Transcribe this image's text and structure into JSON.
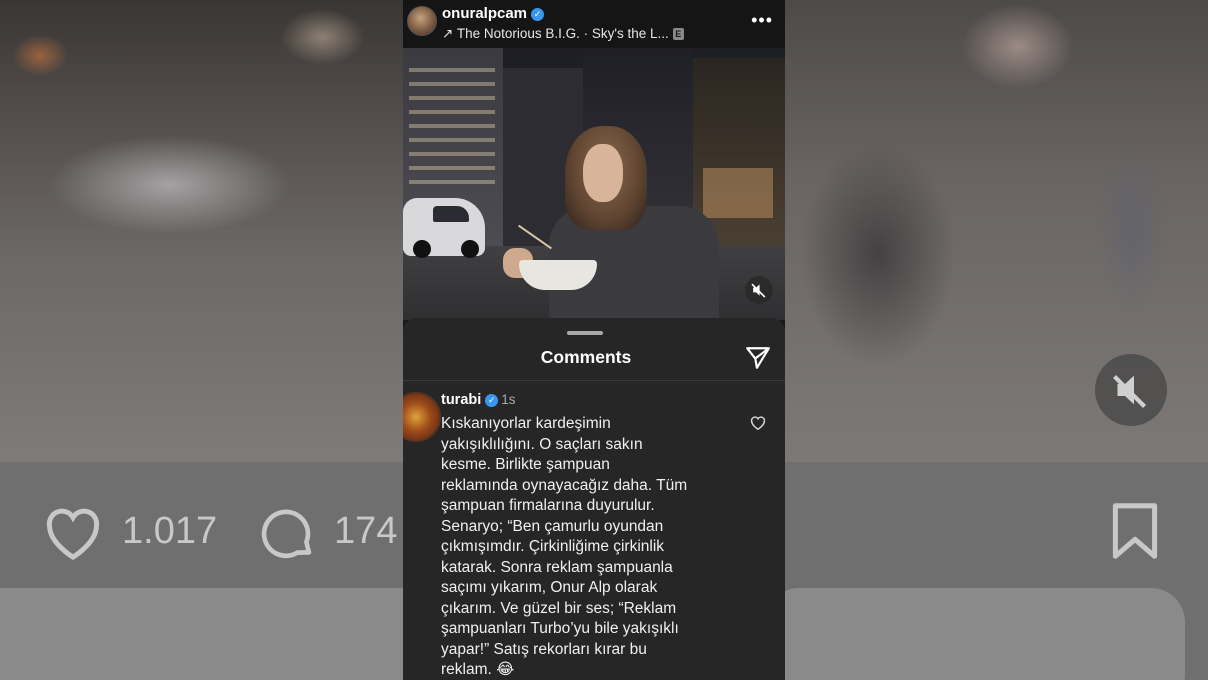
{
  "post": {
    "username": "onuralpcam",
    "music": "↗ The Notorious B.I.G. · Sky's the L...",
    "explicit_badge": "E",
    "more": "•••"
  },
  "background": {
    "likes": "1.017",
    "comments": "174"
  },
  "comments_sheet": {
    "title": "Comments",
    "comment": {
      "user": "turabi",
      "time": "1s",
      "text": "Kıskanıyorlar kardeşimin\nyakışıklılığını. O saçları sakın\nkesme. Birlikte şampuan\nreklamında oynayacağız daha. Tüm\nşampuan firmalarına duyurulur.\nSenaryo; “Ben çamurlu oyundan\nçıkmışımdır. Çirkinliğime çirkinlik\nkatarak. Sonra reklam şampuanla\nsaçımı yıkarım, Onur Alp olarak\nçıkarım.  Ve güzel bir ses; “Reklam\nşampuanları Turbo’yu bile yakışıklı\nyapar!”  Satış rekorları kırar bu\nreklam. 😂"
    }
  },
  "icons": {
    "verified": "verified-badge-icon",
    "share": "send-icon",
    "heart": "heart-icon",
    "mute": "speaker-muted-icon",
    "comment": "comment-bubble-icon",
    "bookmark": "bookmark-icon"
  },
  "colors": {
    "verified_blue": "#3a97f0",
    "sheet_bg": "#262626"
  }
}
